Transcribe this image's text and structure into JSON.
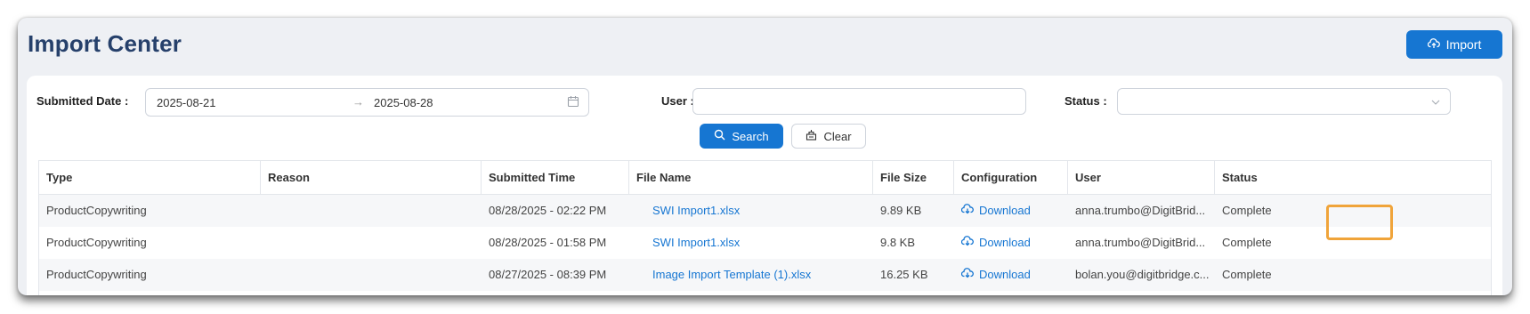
{
  "page": {
    "title": "Import Center",
    "import_label": "Import"
  },
  "filters": {
    "submitted_date_label": "Submitted Date :",
    "date_start": "2025-08-21",
    "date_end": "2025-08-28",
    "date_separator": "→",
    "user_label": "User :",
    "user_value": "",
    "status_label": "Status :",
    "status_value": "",
    "search_label": "Search",
    "clear_label": "Clear"
  },
  "table": {
    "columns": [
      "Type",
      "Reason",
      "Submitted Time",
      "File Name",
      "File Size",
      "Configuration",
      "User",
      "Status"
    ],
    "rows": [
      {
        "type": "ProductCopywriting",
        "reason": "",
        "submitted_time": "08/28/2025 - 02:22 PM",
        "file_name": "SWI Import1.xlsx",
        "file_size": "9.89 KB",
        "configuration": "Download",
        "user": "anna.trumbo@DigitBrid...",
        "status": "Complete"
      },
      {
        "type": "ProductCopywriting",
        "reason": "",
        "submitted_time": "08/28/2025 - 01:58 PM",
        "file_name": "SWI Import1.xlsx",
        "file_size": "9.8 KB",
        "configuration": "Download",
        "user": "anna.trumbo@DigitBrid...",
        "status": "Complete"
      },
      {
        "type": "ProductCopywriting",
        "reason": "",
        "submitted_time": "08/27/2025 - 08:39 PM",
        "file_name": "Image Import Template (1).xlsx",
        "file_size": "16.25 KB",
        "configuration": "Download",
        "user": "bolan.you@digitbridge.c...",
        "status": "Complete"
      }
    ]
  },
  "colors": {
    "primary": "#1676d2",
    "title": "#26406b",
    "highlight": "#f0a43a"
  },
  "icons": {
    "import": "cloud-upload-icon",
    "calendar": "calendar-icon",
    "status_dropdown": "chevron-down-icon",
    "search": "search-icon",
    "clear": "clear-icon",
    "download": "cloud-download-icon"
  }
}
